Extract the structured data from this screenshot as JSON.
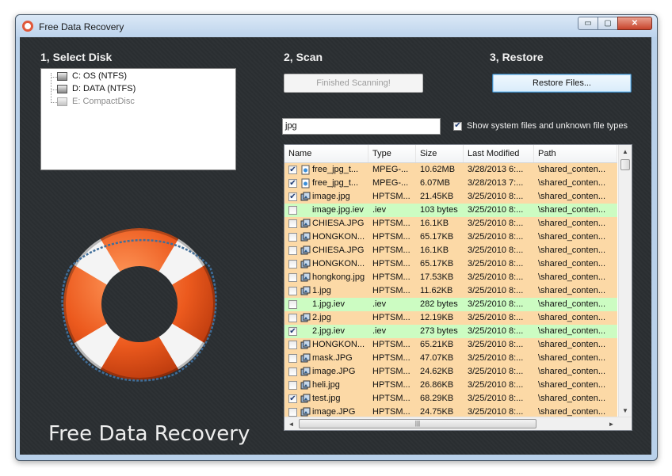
{
  "window": {
    "title": "Free Data Recovery"
  },
  "window_buttons": {
    "minimize": "▭",
    "maximize": "▢",
    "close": "✕"
  },
  "sections": {
    "select_disk": "1, Select Disk",
    "scan": "2, Scan",
    "restore": "3, Restore"
  },
  "disks": [
    {
      "label": "C: OS (NTFS)",
      "enabled": true
    },
    {
      "label": "D: DATA (NTFS)",
      "enabled": true
    },
    {
      "label": "E: CompactDisc",
      "enabled": false
    }
  ],
  "buttons": {
    "scan": "Finished Scanning!",
    "restore": "Restore Files..."
  },
  "filter": {
    "value": "jpg",
    "show_system_label": "Show system files and unknown file types",
    "show_system_checked": true
  },
  "table": {
    "columns": [
      "Name",
      "Type",
      "Size",
      "Last Modified",
      "Path"
    ],
    "rows": [
      {
        "checked": true,
        "icon": "image-file-icon",
        "name": "free_jpg_t...",
        "type": "MPEG-...",
        "size": "10.62MB",
        "modified": "3/28/2013 6:...",
        "path": "\\shared_conten...",
        "color": "orange"
      },
      {
        "checked": true,
        "icon": "image-file-icon",
        "name": "free_jpg_t...",
        "type": "MPEG-...",
        "size": "6.07MB",
        "modified": "3/28/2013 7:...",
        "path": "\\shared_conten...",
        "color": "orange"
      },
      {
        "checked": true,
        "icon": "image-group-icon",
        "name": "image.jpg",
        "type": "HPTSM...",
        "size": "21.45KB",
        "modified": "3/25/2010 8:...",
        "path": "\\shared_conten...",
        "color": "orange"
      },
      {
        "checked": false,
        "icon": "",
        "name": "image.jpg.iev",
        "type": ".iev",
        "size": "103 bytes",
        "modified": "3/25/2010 8:...",
        "path": "\\shared_conten...",
        "color": "green"
      },
      {
        "checked": false,
        "icon": "image-group-icon",
        "name": "CHIESA.JPG",
        "type": "HPTSM...",
        "size": "16.1KB",
        "modified": "3/25/2010 8:...",
        "path": "\\shared_conten...",
        "color": "orange"
      },
      {
        "checked": false,
        "icon": "image-group-icon",
        "name": "HONGKON...",
        "type": "HPTSM...",
        "size": "65.17KB",
        "modified": "3/25/2010 8:...",
        "path": "\\shared_conten...",
        "color": "orange"
      },
      {
        "checked": false,
        "icon": "image-group-icon",
        "name": "CHIESA.JPG",
        "type": "HPTSM...",
        "size": "16.1KB",
        "modified": "3/25/2010 8:...",
        "path": "\\shared_conten...",
        "color": "orange"
      },
      {
        "checked": false,
        "icon": "image-group-icon",
        "name": "HONGKON...",
        "type": "HPTSM...",
        "size": "65.17KB",
        "modified": "3/25/2010 8:...",
        "path": "\\shared_conten...",
        "color": "orange"
      },
      {
        "checked": false,
        "icon": "image-group-icon",
        "name": "hongkong.jpg",
        "type": "HPTSM...",
        "size": "17.53KB",
        "modified": "3/25/2010 8:...",
        "path": "\\shared_conten...",
        "color": "orange"
      },
      {
        "checked": false,
        "icon": "image-group-icon",
        "name": "1.jpg",
        "type": "HPTSM...",
        "size": "11.62KB",
        "modified": "3/25/2010 8:...",
        "path": "\\shared_conten...",
        "color": "orange"
      },
      {
        "checked": false,
        "icon": "",
        "name": "1.jpg.iev",
        "type": ".iev",
        "size": "282 bytes",
        "modified": "3/25/2010 8:...",
        "path": "\\shared_conten...",
        "color": "green"
      },
      {
        "checked": false,
        "icon": "image-group-icon",
        "name": "2.jpg",
        "type": "HPTSM...",
        "size": "12.19KB",
        "modified": "3/25/2010 8:...",
        "path": "\\shared_conten...",
        "color": "orange"
      },
      {
        "checked": true,
        "icon": "",
        "name": "2.jpg.iev",
        "type": ".iev",
        "size": "273 bytes",
        "modified": "3/25/2010 8:...",
        "path": "\\shared_conten...",
        "color": "green"
      },
      {
        "checked": false,
        "icon": "image-group-icon",
        "name": "HONGKON...",
        "type": "HPTSM...",
        "size": "65.21KB",
        "modified": "3/25/2010 8:...",
        "path": "\\shared_conten...",
        "color": "orange"
      },
      {
        "checked": false,
        "icon": "image-group-icon",
        "name": "mask.JPG",
        "type": "HPTSM...",
        "size": "47.07KB",
        "modified": "3/25/2010 8:...",
        "path": "\\shared_conten...",
        "color": "orange"
      },
      {
        "checked": false,
        "icon": "image-group-icon",
        "name": "image.JPG",
        "type": "HPTSM...",
        "size": "24.62KB",
        "modified": "3/25/2010 8:...",
        "path": "\\shared_conten...",
        "color": "orange"
      },
      {
        "checked": false,
        "icon": "image-group-icon",
        "name": "heli.jpg",
        "type": "HPTSM...",
        "size": "26.86KB",
        "modified": "3/25/2010 8:...",
        "path": "\\shared_conten...",
        "color": "orange"
      },
      {
        "checked": true,
        "icon": "image-group-icon",
        "name": "test.jpg",
        "type": "HPTSM...",
        "size": "68.29KB",
        "modified": "3/25/2010 8:...",
        "path": "\\shared_conten...",
        "color": "orange"
      },
      {
        "checked": false,
        "icon": "image-group-icon",
        "name": "image.JPG",
        "type": "HPTSM...",
        "size": "24.75KB",
        "modified": "3/25/2010 8:...",
        "path": "\\shared_conten...",
        "color": "orange"
      }
    ]
  },
  "scrollbars": {
    "up": "▲",
    "down": "▼",
    "left": "◄",
    "right": "►",
    "grip": "|||"
  },
  "brand_text": "Free Data Recovery",
  "colors": {
    "row_orange": "#fcd9a6",
    "row_green": "#ccfcc2",
    "background": "#2a2e31",
    "buoy_orange": "#ec5a1e"
  }
}
